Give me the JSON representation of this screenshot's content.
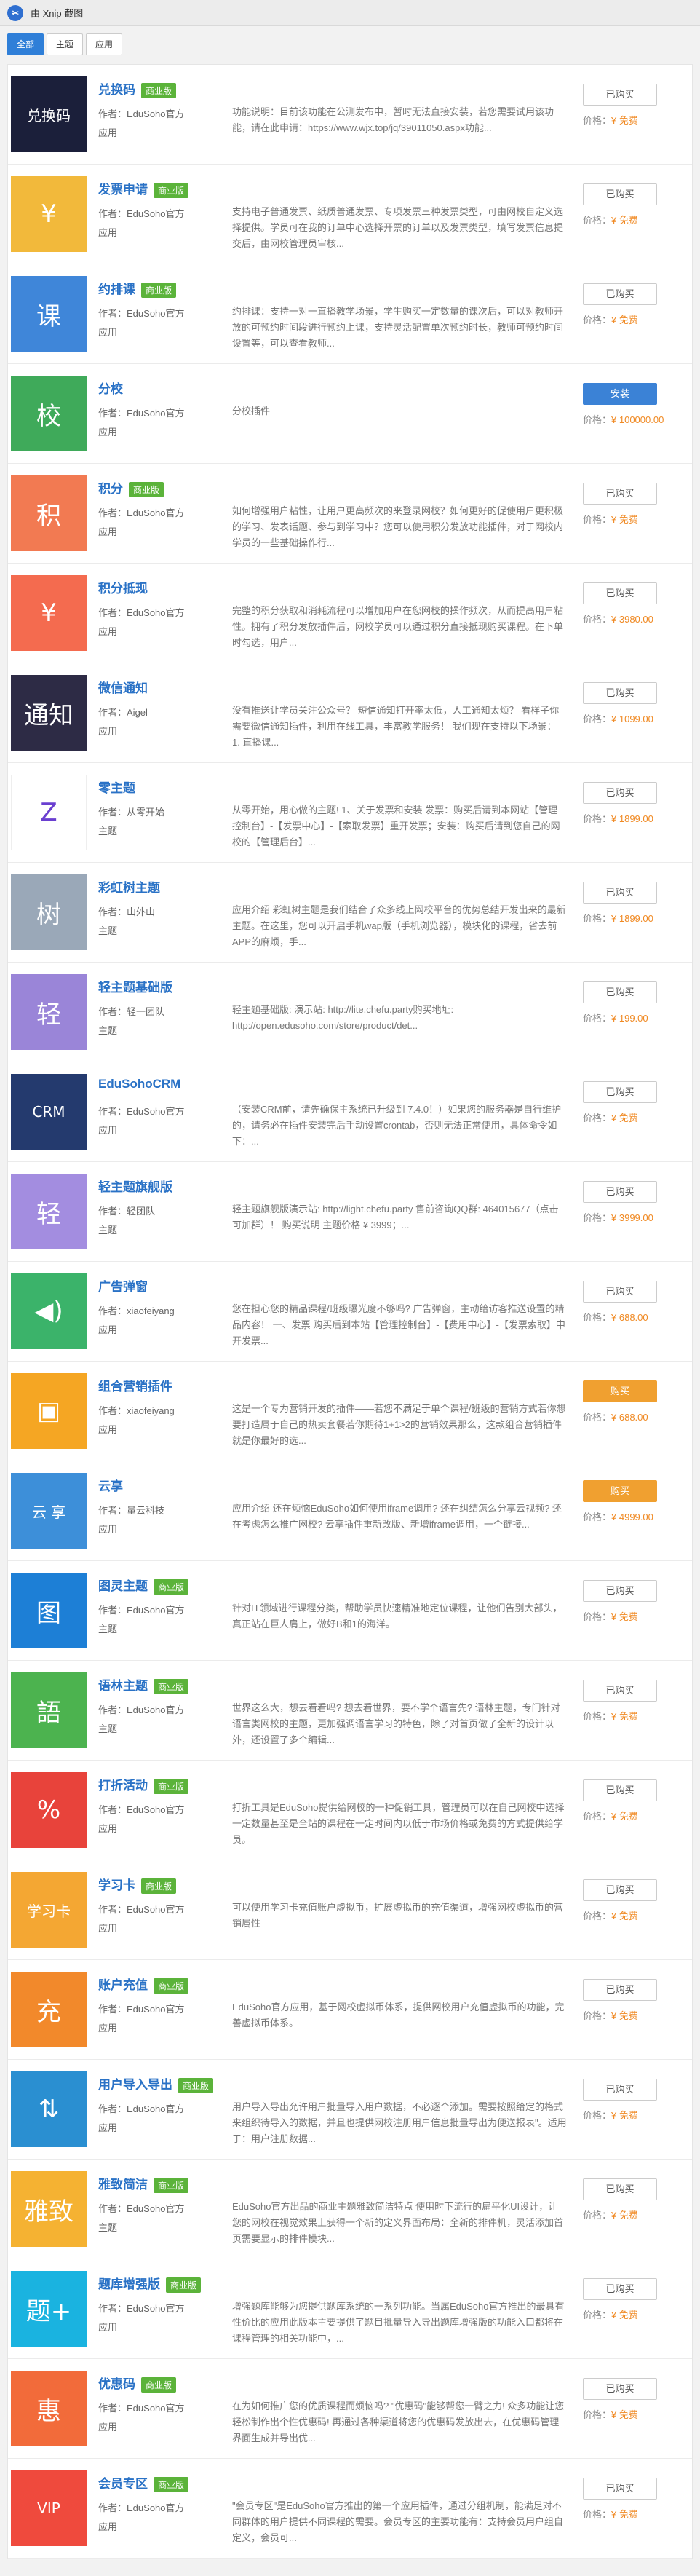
{
  "window": {
    "title": "由 Xnip 截图"
  },
  "tabs": [
    {
      "label": "全部",
      "active": true
    },
    {
      "label": "主题",
      "active": false
    },
    {
      "label": "应用",
      "active": false
    }
  ],
  "labels": {
    "author_prefix": "作者：",
    "price_prefix": "价格：",
    "new_badge": "商业版"
  },
  "items": [
    {
      "name": "兑换码",
      "badge": true,
      "author": "EduSoho官方",
      "type": "应用",
      "desc": "功能说明：目前该功能在公测发布中，暂时无法直接安装，若您需要试用该功能，请在此申请：https://www.wjx.top/jq/39011050.aspx功能...",
      "button": "已购买",
      "btn_style": "normal",
      "price": "¥ 免费",
      "icon": "redeem-code-icon",
      "thumb_text": "兑换码",
      "thumb_color": "#1b1f3a"
    },
    {
      "name": "发票申请",
      "badge": true,
      "author": "EduSoho官方",
      "type": "应用",
      "desc": "支持电子普通发票、纸质普通发票、专项发票三种发票类型，可由网校自定义选择提供。学员可在我的订单中心选择开票的订单以及发票类型，填写发票信息提交后，由网校管理员审核...",
      "button": "已购买",
      "btn_style": "normal",
      "price": "¥ 免费",
      "icon": "invoice-icon",
      "thumb_text": "¥",
      "thumb_color": "#f2b93b"
    },
    {
      "name": "约排课",
      "badge": true,
      "author": "EduSoho官方",
      "type": "应用",
      "desc": "约排课：支持一对一直播教学场景，学生购买一定数量的课次后，可以对教师开放的可预约时间段进行预约上课，支持灵活配置单次预约时长，教师可预约时间设置等，可以查看教师...",
      "button": "已购买",
      "btn_style": "normal",
      "price": "¥ 免费",
      "icon": "schedule-icon",
      "thumb_text": "课",
      "thumb_color": "#3f86d9"
    },
    {
      "name": "分校",
      "badge": false,
      "author": "EduSoho官方",
      "type": "应用",
      "desc": "分校插件",
      "button": "安装",
      "btn_style": "install",
      "price": "¥ 100000.00",
      "icon": "branch-school-icon",
      "thumb_text": "校",
      "thumb_color": "#3faa5a"
    },
    {
      "name": "积分",
      "badge": true,
      "author": "EduSoho官方",
      "type": "应用",
      "desc": "如何增强用户粘性，让用户更高频次的来登录网校？如何更好的促使用户更积极的学习、发表话题、参与到学习中？您可以使用积分发放功能插件，对于网校内学员的一些基础操作行...",
      "button": "已购买",
      "btn_style": "normal",
      "price": "¥ 免费",
      "icon": "points-icon",
      "thumb_text": "积",
      "thumb_color": "#f27a52"
    },
    {
      "name": "积分抵现",
      "badge": false,
      "author": "EduSoho官方",
      "type": "应用",
      "desc": "完整的积分获取和消耗流程可以增加用户在您网校的操作频次，从而提高用户粘性。拥有了积分发放插件后，网校学员可以通过积分直接抵现购买课程。在下单时勾选，用户...",
      "button": "已购买",
      "btn_style": "normal",
      "price": "¥ 3980.00",
      "icon": "points-cash-icon",
      "thumb_text": "¥",
      "thumb_color": "#f46b4f"
    },
    {
      "name": "微信通知",
      "badge": false,
      "author": "Aigel",
      "type": "应用",
      "desc": "没有推送让学员关注公众号？ 短信通知打开率太低，人工通知太烦？ 看样子你需要微信通知插件，利用在线工具，丰富教学服务！ 我们现在支持以下场景： 1. 直播课...",
      "button": "已购买",
      "btn_style": "normal",
      "price": "¥ 1099.00",
      "icon": "wechat-notify-icon",
      "thumb_text": "通知",
      "thumb_color": "#2d2b45"
    },
    {
      "name": "零主题",
      "badge": false,
      "author": "从零开始",
      "type": "主题",
      "desc": "从零开始，用心做的主题! 1、关于发票和安装 发票：购买后请到本网站【管理控制台】-【发票中心】-【索取发票】重开发票；安装：购买后请到您自己的网校的【管理后台】...",
      "button": "已购买",
      "btn_style": "normal",
      "price": "¥ 1899.00",
      "icon": "zero-theme-icon",
      "thumb_text": "Z",
      "thumb_color": "#ffffff"
    },
    {
      "name": "彩虹树主题",
      "badge": false,
      "author": "山外山",
      "type": "主题",
      "desc": "应用介绍 彩虹树主题是我们结合了众多线上网校平台的优势总结开发出来的最新主题。在这里，您可以开启手机wap版（手机浏览器），模块化的课程，省去前APP的麻烦，手...",
      "button": "已购买",
      "btn_style": "normal",
      "price": "¥ 1899.00",
      "icon": "rainbow-tree-icon",
      "thumb_text": "树",
      "thumb_color": "#9aa8b8"
    },
    {
      "name": "轻主题基础版",
      "badge": false,
      "author": "轻一团队",
      "type": "主题",
      "desc": "轻主题基础版: 演示站: http://lite.chefu.party购买地址: http://open.edusoho.com/store/product/det...",
      "button": "已购买",
      "btn_style": "normal",
      "price": "¥ 199.00",
      "icon": "light-theme-basic-icon",
      "thumb_text": "轻",
      "thumb_color": "#9a85d8"
    },
    {
      "name": "EduSohoCRM",
      "badge": false,
      "author": "EduSoho官方",
      "type": "应用",
      "desc": "（安装CRM前，请先确保主系统已升级到 7.4.0！）如果您的服务器是自行维护的，请务必在插件安装完后手动设置crontab，否则无法正常使用，具体命令如下：...",
      "button": "已购买",
      "btn_style": "normal",
      "price": "¥ 免费",
      "icon": "crm-icon",
      "thumb_text": "CRM",
      "thumb_color": "#243a6e"
    },
    {
      "name": "轻主题旗舰版",
      "badge": false,
      "author": "轻团队",
      "type": "主题",
      "desc": "轻主题旗舰版演示站: http://light.chefu.party 售前咨询QQ群: 464015677（点击可加群）！ 购买说明 主题价格 ¥ 3999；...",
      "button": "已购买",
      "btn_style": "normal",
      "price": "¥ 3999.00",
      "icon": "light-theme-flagship-icon",
      "thumb_text": "轻",
      "thumb_color": "#a38de0"
    },
    {
      "name": "广告弹窗",
      "badge": false,
      "author": "xiaofeiyang",
      "type": "应用",
      "desc": "您在担心您的精品课程/班级曝光度不够吗? 广告弹窗，主动给访客推送设置的精品内容！ 一、发票 购买后到本站【管理控制台】-【费用中心】-【发票索取】中开发票...",
      "button": "已购买",
      "btn_style": "normal",
      "price": "¥ 688.00",
      "icon": "popup-ad-icon",
      "thumb_text": "◀)",
      "thumb_color": "#3bb36a"
    },
    {
      "name": "组合营销插件",
      "badge": false,
      "author": "xiaofeiyang",
      "type": "应用",
      "desc": "这是一个专为营销开发的插件——若您不满足于单个课程/班级的营销方式若你想要打造属于自己的热卖套餐若你期待1+1>2的营销效果那么，这款组合营销插件就是你最好的选...",
      "button": "购买",
      "btn_style": "buy",
      "price": "¥ 688.00",
      "icon": "combo-marketing-icon",
      "thumb_text": "▣",
      "thumb_color": "#f5a623"
    },
    {
      "name": "云享",
      "badge": false,
      "author": "量云科技",
      "type": "应用",
      "desc": "应用介绍 还在烦恼EduSoho如何使用iframe调用? 还在纠结怎么分享云视频? 还在考虑怎么推广网校? 云享插件重新改版、新增iframe调用，一个链接...",
      "button": "购买",
      "btn_style": "buy",
      "price": "¥ 4999.00",
      "icon": "cloud-share-icon",
      "thumb_text": "云 享",
      "thumb_color": "#3d8fd9"
    },
    {
      "name": "图灵主题",
      "badge": true,
      "author": "EduSoho官方",
      "type": "主题",
      "desc": "针对IT领域进行课程分类，帮助学员快速精准地定位课程，让他们告别大部头，真正站在巨人肩上，做好B和1的海洋。",
      "button": "已购买",
      "btn_style": "normal",
      "price": "¥ 免费",
      "icon": "turing-theme-icon",
      "thumb_text": "图",
      "thumb_color": "#1d7fd6"
    },
    {
      "name": "语林主题",
      "badge": true,
      "author": "EduSoho官方",
      "type": "主题",
      "desc": "世界这么大，想去看看吗? 想去看世界，要不学个语言先? 语林主题，专门针对语言类网校的主题，更加强调语言学习的特色，除了对首页做了全新的设计以外，还设置了多个编辑...",
      "button": "已购买",
      "btn_style": "normal",
      "price": "¥ 免费",
      "icon": "yulin-theme-icon",
      "thumb_text": "語",
      "thumb_color": "#4cb34f"
    },
    {
      "name": "打折活动",
      "badge": true,
      "author": "EduSoho官方",
      "type": "应用",
      "desc": "打折工具是EduSoho提供给网校的一种促销工具，管理员可以在自己网校中选择一定数量甚至是全站的课程在一定时间内以低于市场价格或免费的方式提供给学员。",
      "button": "已购买",
      "btn_style": "normal",
      "price": "¥ 免费",
      "icon": "discount-icon",
      "thumb_text": "%",
      "thumb_color": "#e8433b"
    },
    {
      "name": "学习卡",
      "badge": true,
      "author": "EduSoho官方",
      "type": "应用",
      "desc": "可以使用学习卡充值账户虚拟币，扩展虚拟币的充值渠道，增强网校虚拟币的营销属性",
      "button": "已购买",
      "btn_style": "normal",
      "price": "¥ 免费",
      "icon": "study-card-icon",
      "thumb_text": "学习卡",
      "thumb_color": "#f4a733"
    },
    {
      "name": "账户充值",
      "badge": true,
      "author": "EduSoho官方",
      "type": "应用",
      "desc": "EduSoho官方应用，基于网校虚拟币体系，提供网校用户充值虚拟币的功能，完善虚拟币体系。",
      "button": "已购买",
      "btn_style": "normal",
      "price": "¥ 免费",
      "icon": "recharge-icon",
      "thumb_text": "充",
      "thumb_color": "#f2892b"
    },
    {
      "name": "用户导入导出",
      "badge": true,
      "author": "EduSoho官方",
      "type": "应用",
      "desc": "用户导入导出允许用户批量导入用户数据，不必逐个添加。需要按照给定的格式来组织待导入的数据，并且也提供网校注册用户信息批量导出为便送报表\"。适用于：用户注册数据...",
      "button": "已购买",
      "btn_style": "normal",
      "price": "¥ 免费",
      "icon": "user-import-export-icon",
      "thumb_text": "⇅",
      "thumb_color": "#2a8fd1"
    },
    {
      "name": "雅致简洁",
      "badge": true,
      "author": "EduSoho官方",
      "type": "主题",
      "desc": "EduSoho官方出品的商业主题雅致简洁特点 使用时下流行的扁平化UI设计，让您的网校在视觉效果上获得一个新的定义界面布局：全新的排件机，灵活添加首页需要显示的排件模块...",
      "button": "已购买",
      "btn_style": "normal",
      "price": "¥ 免费",
      "icon": "elegant-theme-icon",
      "thumb_text": "雅致",
      "thumb_color": "#f5b232"
    },
    {
      "name": "题库增强版",
      "badge": true,
      "author": "EduSoho官方",
      "type": "应用",
      "desc": "增强题库能够为您提供题库系统的一系列功能。当属EduSoho官方推出的最具有性价比的应用此版本主要提供了题目批量导入导出题库增强版的功能入口都将在课程管理的相关功能中，...",
      "button": "已购买",
      "btn_style": "normal",
      "price": "¥ 免费",
      "icon": "question-bank-icon",
      "thumb_text": "题+",
      "thumb_color": "#1ab3e0"
    },
    {
      "name": "优惠码",
      "badge": true,
      "author": "EduSoho官方",
      "type": "应用",
      "desc": "在为如何推广您的优质课程而烦恼吗? \"优惠码\"能够帮您一臂之力! 众多功能让您轻松制作出个性优惠码! 再通过各种渠道将您的优惠码发放出去，在优惠码管理界面生成并导出优...",
      "button": "已购买",
      "btn_style": "normal",
      "price": "¥ 免费",
      "icon": "coupon-icon",
      "thumb_text": "惠",
      "thumb_color": "#f26b3a"
    },
    {
      "name": "会员专区",
      "badge": true,
      "author": "EduSoho官方",
      "type": "应用",
      "desc": "\"会员专区\"是EduSoho官方推出的第一个应用插件，通过分组机制，能满足对不同群体的用户提供不同课程的需要。会员专区的主要功能有：支持会员用户组自定义，会员可...",
      "button": "已购买",
      "btn_style": "normal",
      "price": "¥ 免费",
      "icon": "vip-zone-icon",
      "thumb_text": "VIP",
      "thumb_color": "#ef4a3d"
    }
  ]
}
